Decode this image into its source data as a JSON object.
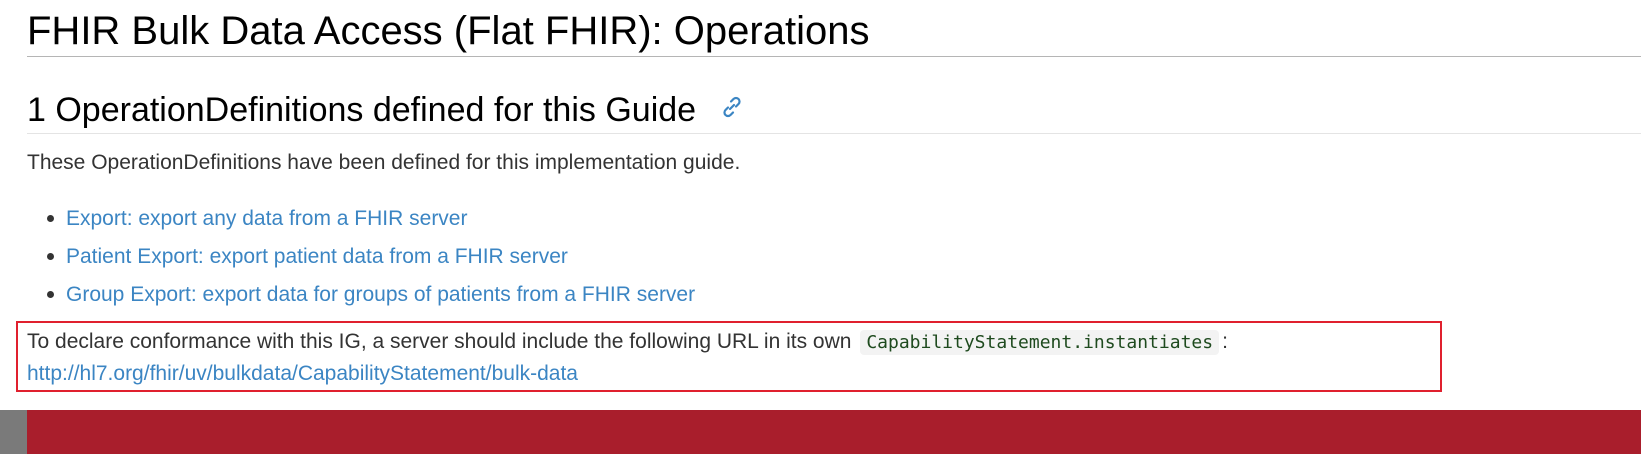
{
  "page": {
    "title": "FHIR Bulk Data Access (Flat FHIR): Operations"
  },
  "section": {
    "heading": "1 OperationDefinitions defined for this Guide",
    "anchor_icon": "link-icon",
    "intro": "These OperationDefinitions have been defined for this implementation guide.",
    "operations": [
      {
        "label": "Export: export any data from a FHIR server"
      },
      {
        "label": "Patient Export: export patient data from a FHIR server"
      },
      {
        "label": "Group Export: export data for groups of patients from a FHIR server"
      }
    ]
  },
  "conformance": {
    "text_before": "To declare conformance with this IG, a server should include the following URL in its own",
    "code": "CapabilityStatement.instantiates",
    "text_after": ":",
    "url": "http://hl7.org/fhir/uv/bulkdata/CapabilityStatement/bulk-data",
    "highlight_color": "#e0202e"
  },
  "colors": {
    "link": "#3b85c3",
    "footer": "#a91e2c"
  }
}
